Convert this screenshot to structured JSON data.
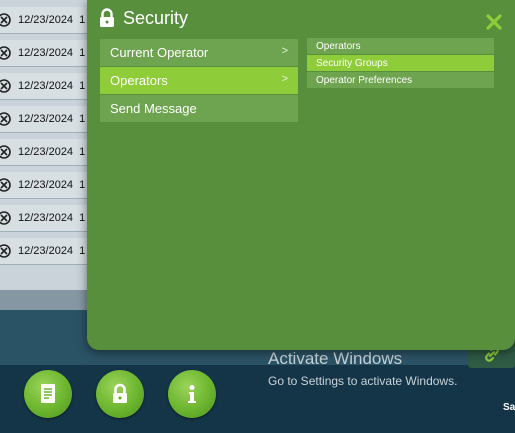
{
  "background_table": {
    "rows": [
      {
        "date": "12/23/2024",
        "trunc": "1"
      },
      {
        "date": "12/23/2024",
        "trunc": "1"
      },
      {
        "date": "12/23/2024",
        "trunc": "1"
      },
      {
        "date": "12/23/2024",
        "trunc": "1"
      },
      {
        "date": "12/23/2024",
        "trunc": "1"
      },
      {
        "date": "12/23/2024",
        "trunc": "1"
      },
      {
        "date": "12/23/2024",
        "trunc": "1"
      },
      {
        "date": "12/23/2024",
        "trunc": "1"
      }
    ]
  },
  "security_panel": {
    "title": "Security",
    "menu": [
      {
        "label": "Current Operator",
        "chevron": ">"
      },
      {
        "label": "Operators",
        "chevron": ">",
        "selected": true
      },
      {
        "label": "Send Message",
        "chevron": ""
      }
    ],
    "submenu": [
      {
        "label": "Operators"
      },
      {
        "label": "Security Groups",
        "selected": true
      },
      {
        "label": "Operator Preferences"
      }
    ],
    "accent_color": "#8fcc3a",
    "panel_color": "#588f3c"
  },
  "watermark": {
    "title": "Activate Windows",
    "subtitle": "Go to Settings to activate Windows."
  },
  "bottom_bar": {
    "buttons": [
      {
        "icon": "document-icon"
      },
      {
        "icon": "lock-icon"
      },
      {
        "icon": "info-icon"
      }
    ],
    "edge_text": "Sa"
  }
}
